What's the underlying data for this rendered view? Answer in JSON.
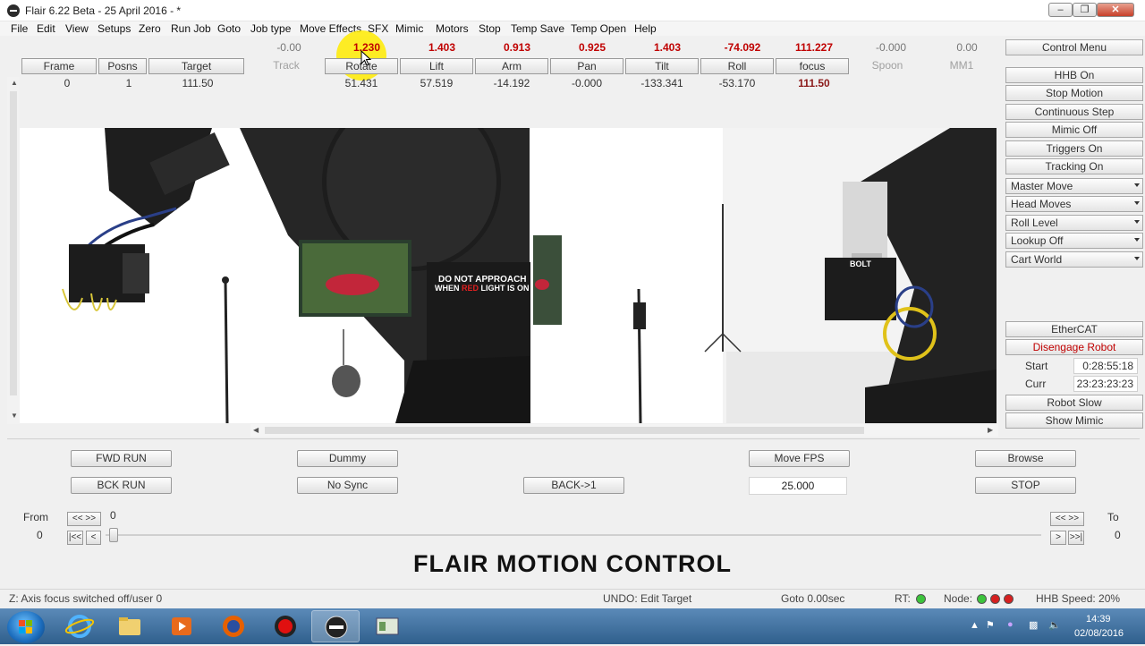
{
  "window": {
    "title": "Flair 6.22 Beta - 25 April 2016 -  *"
  },
  "menu": [
    "File",
    "Edit",
    "View",
    "Setups",
    "Zero",
    "Run Job",
    "Goto",
    "Job type",
    "Move Effects",
    "SFX",
    "Mimic",
    "Motors",
    "Stop",
    "Temp Save",
    "Temp Open",
    "Help"
  ],
  "axes": {
    "top_values": [
      "-0.00",
      "1.230",
      "1.403",
      "0.913",
      "0.925",
      "1.403",
      "-74.092",
      "111.227",
      "-0.000",
      "0.00"
    ],
    "headers": [
      "Frame",
      "Posns",
      "Target",
      "Track",
      "Rotate",
      "Lift",
      "Arm",
      "Pan",
      "Tilt",
      "Roll",
      "focus",
      "Spoon",
      "MM1"
    ],
    "row": [
      "0",
      "1",
      "111.50",
      "51.431",
      "57.519",
      "-14.192",
      "-0.000",
      "-133.341",
      "-53.170",
      "111.50"
    ]
  },
  "right_panel": {
    "control_menu": "Control Menu",
    "buttons": [
      "HHB On",
      "Stop Motion",
      "Continuous Step",
      "Mimic Off",
      "Triggers On",
      "Tracking On"
    ],
    "dropdowns": [
      "Master Move",
      "Head Moves",
      "Roll Level",
      "Lookup Off",
      "Cart World"
    ],
    "ethercat": "EtherCAT",
    "disengage": "Disengage Robot",
    "start_label": "Start",
    "start_value": "0:28:55:18",
    "curr_label": "Curr",
    "curr_value": "23:23:23:23",
    "robot_slow": "Robot Slow",
    "show_mimic": "Show Mimic"
  },
  "video": {
    "sign_line1": "DO NOT APPROACH",
    "sign_line2a": "WHEN ",
    "sign_line2b": "RED",
    "sign_line2c": " LIGHT IS ON",
    "robot_label": "BOLT"
  },
  "controls": {
    "fwd_run": "FWD RUN",
    "bck_run": "BCK RUN",
    "dummy": "Dummy",
    "no_sync": "No Sync",
    "back1": "BACK->1",
    "move_fps": "Move FPS",
    "fps_value": "25.000",
    "browse": "Browse",
    "stop": "STOP",
    "from_label": "From",
    "from_value": "0",
    "to_label": "To",
    "to_value": "0",
    "slider_value": "0",
    "btn_swap": "<< >>",
    "btn_first": "|<<",
    "btn_prev": "<",
    "btn_next": ">",
    "btn_last": ">>|"
  },
  "brand": "FLAIR MOTION CONTROL",
  "status": {
    "message": "Z: Axis focus switched off/user 0",
    "undo": "UNDO: Edit Target",
    "goto": "Goto 0.00sec",
    "rt": "RT:",
    "node": "Node:",
    "hhb_speed": "HHB Speed: 20%"
  },
  "taskbar": {
    "time": "14:39",
    "date": "02/08/2016"
  },
  "colors": {
    "red_value": "#c00000",
    "led_green": "#3cc43c",
    "led_red": "#d62020"
  }
}
